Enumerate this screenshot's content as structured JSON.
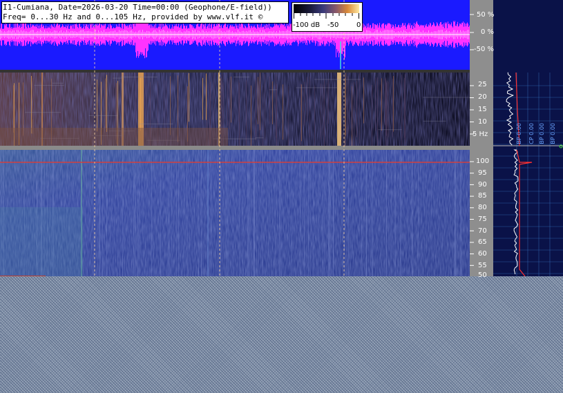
{
  "header": {
    "line1": "I1-Cumiana, Date=2026-03-20 Time=00:00 (Geophone/E-field))",
    "line2": "Freq= 0...30 Hz and 0...105 Hz, provided by www.vlf.it ©"
  },
  "colorbar": {
    "labels": [
      "-100 dB",
      "-50",
      "0"
    ]
  },
  "side_labels": [
    "BP 0.00",
    "CP 0.00",
    "BP 0.00",
    "BP 0.00"
  ],
  "chart_data": [
    {
      "type": "area",
      "name": "waveform",
      "ylabel": "",
      "yticks": [
        "50 %",
        "0 %",
        "-50 %"
      ],
      "ylim": [
        -100,
        100
      ],
      "colors": {
        "background": "#1a1aff",
        "signal": "#ff33ff",
        "baseline": "#ffffff"
      }
    },
    {
      "type": "heatmap",
      "name": "spectrogram-0-30Hz",
      "yticks": [
        "25",
        "20",
        "15",
        "10",
        "5 Hz"
      ],
      "ylim": [
        0,
        30
      ],
      "colors": {
        "low": "#0a0a1e",
        "mid": "#3a3a7a",
        "high": "#ffb050"
      }
    },
    {
      "type": "heatmap",
      "name": "spectrogram-50-105Hz",
      "yticks": [
        "100",
        "95",
        "90",
        "85",
        "80",
        "75",
        "70",
        "65",
        "60",
        "55",
        "50"
      ],
      "ylim": [
        50,
        105
      ],
      "colors": {
        "low": "#2a3a8a",
        "mid": "#4a5aaa",
        "high": "#60b0a0"
      }
    }
  ]
}
